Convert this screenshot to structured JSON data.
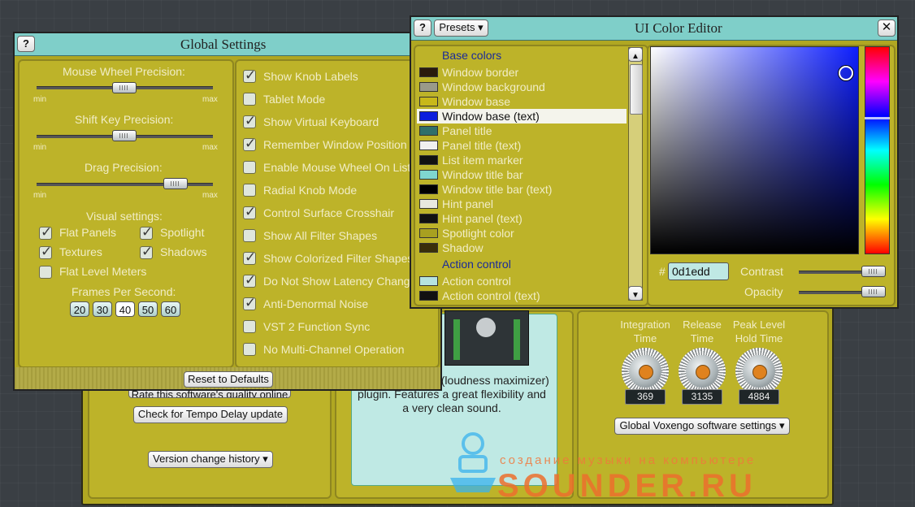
{
  "global_settings": {
    "title": "Global Settings",
    "help": "?",
    "sliders": [
      {
        "label": "Mouse Wheel Precision:",
        "min": "min",
        "max": "max",
        "level": 0.5
      },
      {
        "label": "Shift Key Precision:",
        "min": "min",
        "max": "max",
        "level": 0.5
      },
      {
        "label": "Drag Precision:",
        "min": "min",
        "max": "max",
        "level": 0.78
      }
    ],
    "visual_settings_label": "Visual settings:",
    "visual_checks": [
      {
        "label": "Flat Panels",
        "checked": true
      },
      {
        "label": "Spotlight",
        "checked": true
      },
      {
        "label": "Textures",
        "checked": true
      },
      {
        "label": "Shadows",
        "checked": true
      },
      {
        "label": "Flat Level Meters",
        "checked": false
      }
    ],
    "fps_label": "Frames Per Second:",
    "fps_options": [
      "20",
      "30",
      "40",
      "50",
      "60"
    ],
    "fps_selected": "40",
    "options": [
      {
        "label": "Show Knob Labels",
        "checked": true
      },
      {
        "label": "Tablet Mode",
        "checked": false
      },
      {
        "label": "Show Virtual Keyboard",
        "checked": true
      },
      {
        "label": "Remember Window Position",
        "checked": true
      },
      {
        "label": "Enable Mouse Wheel On List",
        "checked": false
      },
      {
        "label": "Radial Knob Mode",
        "checked": false
      },
      {
        "label": "Control Surface Crosshair",
        "checked": true
      },
      {
        "label": "Show All Filter Shapes",
        "checked": false
      },
      {
        "label": "Show Colorized Filter Shapes",
        "checked": true
      },
      {
        "label": "Do Not Show Latency Changes",
        "checked": true
      },
      {
        "label": "Anti-Denormal Noise",
        "checked": true
      },
      {
        "label": "VST 2 Function Sync",
        "checked": false
      },
      {
        "label": "No Multi-Channel Operation",
        "checked": false
      }
    ],
    "reset_button": "Reset to Defaults"
  },
  "background_window": {
    "rate_button": "Rate this software's quality online",
    "tempo_button": "Check for Tempo Delay update",
    "history_button": "Version change history ▾",
    "description": "mastering limiter (loudness maximizer) plugin. Features a great flexibility and a very clean sound.",
    "knobs": [
      {
        "label": "Integration Time",
        "value": "369"
      },
      {
        "label": "Release Time",
        "value": "3135"
      },
      {
        "label": "Peak Level Hold Time",
        "value": "4884"
      }
    ],
    "global_button": "Global Voxengo software settings ▾"
  },
  "color_editor": {
    "title": "UI Color Editor",
    "help": "?",
    "presets": "Presets ▾",
    "close": "✕",
    "groups": [
      {
        "header": "Base colors",
        "items": [
          {
            "label": "Window border",
            "color": "#2a1a0c"
          },
          {
            "label": "Window background",
            "color": "#9a9a8a"
          },
          {
            "label": "Window base",
            "color": "#c8b81a"
          },
          {
            "label": "Window base (text)",
            "color": "#0d1edd",
            "selected": true
          },
          {
            "label": "Panel title",
            "color": "#2f6f6a"
          },
          {
            "label": "Panel title (text)",
            "color": "#f0f0f0"
          },
          {
            "label": "List item marker",
            "color": "#111111"
          },
          {
            "label": "Window title bar",
            "color": "#7fd6cf"
          },
          {
            "label": "Window title bar (text)",
            "color": "#000000"
          },
          {
            "label": "Hint panel",
            "color": "#e8e8e0"
          },
          {
            "label": "Hint panel (text)",
            "color": "#111111"
          },
          {
            "label": "Spotlight color",
            "color": "#a8a020"
          },
          {
            "label": "Shadow",
            "color": "#3a2f0a"
          }
        ]
      },
      {
        "header": "Action control",
        "items": [
          {
            "label": "Action control",
            "color": "#b6e3e0"
          },
          {
            "label": "Action control (text)",
            "color": "#111111"
          }
        ]
      }
    ],
    "hex_prefix": "#",
    "hex_value": "0d1edd",
    "contrast_label": "Contrast",
    "opacity_label": "Opacity",
    "contrast_level": 1.0,
    "opacity_level": 1.0
  },
  "watermark": {
    "tagline": "создание музыки на компьютере",
    "brand": "SOUNDER.RU"
  }
}
